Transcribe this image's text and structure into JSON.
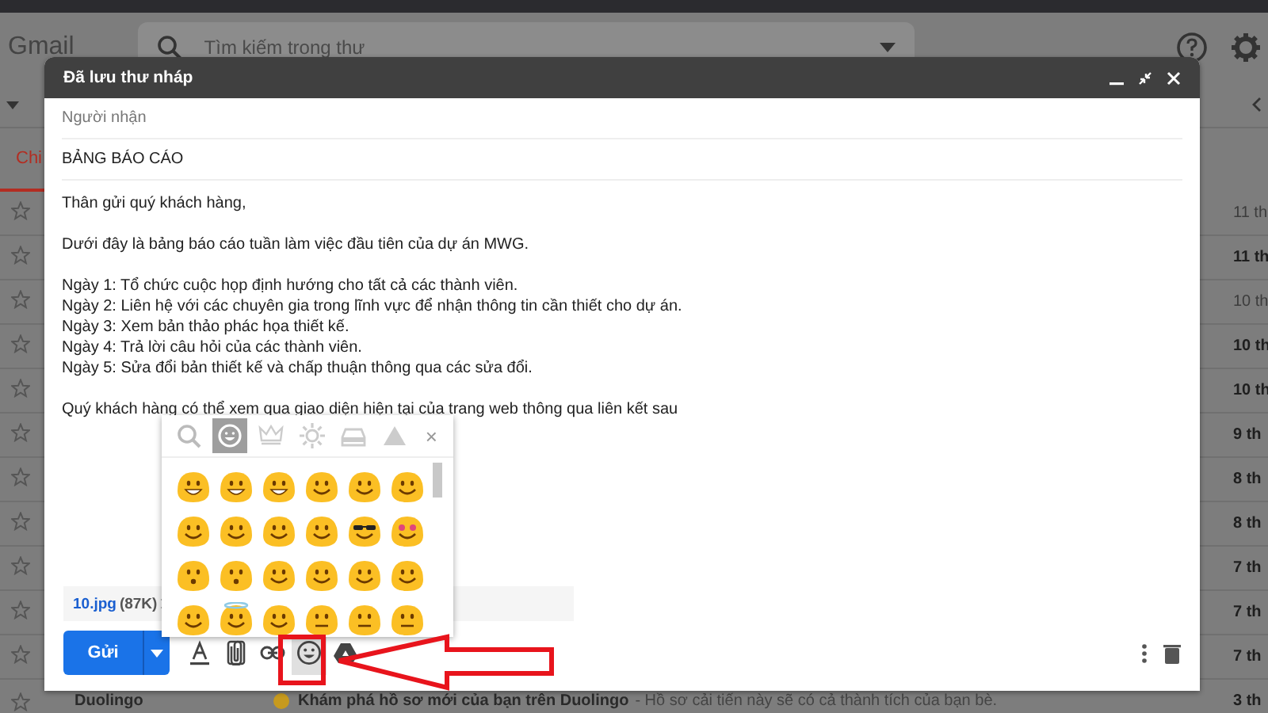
{
  "top_bar": {
    "logo": "Gmail",
    "search": {
      "placeholder": "Tìm kiếm trong thư"
    }
  },
  "tabs": [
    {
      "label": "Chi",
      "selected": true
    }
  ],
  "mail_rows": [
    {
      "date": "11 th",
      "unread": false
    },
    {
      "date": "11 th",
      "unread": true
    },
    {
      "date": "10 th",
      "unread": false
    },
    {
      "date": "10 th",
      "unread": true
    },
    {
      "date": "10 th",
      "unread": true
    },
    {
      "date": "9 th",
      "unread": true
    },
    {
      "date": "8 th",
      "unread": true
    },
    {
      "date": "8 th",
      "unread": true
    },
    {
      "date": "7 th",
      "unread": true
    },
    {
      "date": "7 th",
      "unread": true
    },
    {
      "date": "7 th",
      "unread": true
    },
    {
      "sender": "Duolingo",
      "subject": "Khám phá hồ sơ mới của bạn trên Duolingo",
      "snippet": "- Hồ sơ cải tiến này sẽ có cả thành tích của bạn bè.",
      "date": "3 th",
      "unread": true
    }
  ],
  "compose": {
    "title": "Đã lưu thư nháp",
    "recipients": {
      "placeholder": "Người nhận"
    },
    "subject": {
      "value": "BẢNG BÁO CÁO"
    },
    "body": [
      [
        "Thân gửi quý khách hàng,"
      ],
      [
        "Dưới đây là bảng báo cáo tuần làm việc đầu tiên của dự án MWG."
      ],
      [
        "Ngày 1: Tổ chức cuộc họp định hướng cho tất cả các thành viên.",
        "Ngày 2: Liên hệ với các chuyên gia trong lĩnh vực để nhận thông tin cần thiết cho dự án.",
        "Ngày 3: Xem bản thảo phác họa thiết kế.",
        "Ngày 4: Trả lời câu hỏi của các thành viên.",
        "Ngày 5: Sửa đổi bản thiết kế và chấp thuận thông qua các sửa đổi."
      ],
      [
        "Quý khách hàng có thể xem qua giao diện hiện tại của trang web thông qua liên kết sau"
      ]
    ],
    "attachment": {
      "name": "10.jpg",
      "size": "(87K)"
    },
    "send_button": "Gửi",
    "toolbar": [
      {
        "kind": "format",
        "active": false
      },
      {
        "kind": "attach",
        "active": false
      },
      {
        "kind": "link",
        "active": false
      },
      {
        "kind": "emoji",
        "active": true
      },
      {
        "kind": "drive",
        "active": false
      }
    ],
    "emoji_picker": {
      "tabs": [
        {
          "kind": "search",
          "selected": false
        },
        {
          "kind": "smiley",
          "selected": true
        },
        {
          "kind": "crown",
          "selected": false
        },
        {
          "kind": "gear",
          "selected": false
        },
        {
          "kind": "car",
          "selected": false
        },
        {
          "kind": "triangle",
          "selected": false
        }
      ],
      "close": "×"
    }
  }
}
